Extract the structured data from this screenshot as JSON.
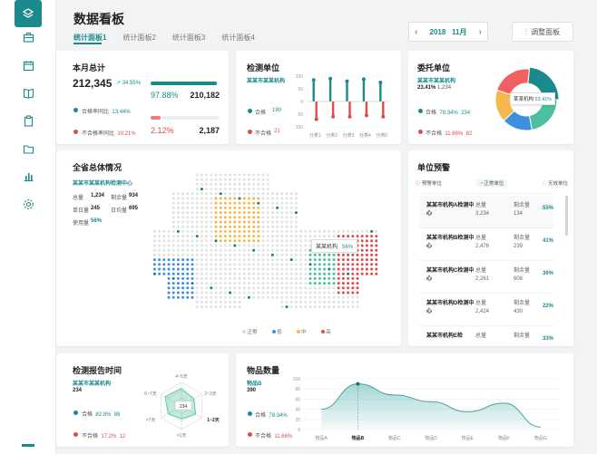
{
  "header": {
    "title": "数据看板",
    "tabs": [
      "统计面板1",
      "统计面板2",
      "统计面板3",
      "统计面板4"
    ],
    "year": "2018",
    "month": "11月",
    "adjust_label": "调整面板"
  },
  "sidebar": {
    "icons": [
      "layers-icon",
      "briefcase-icon",
      "calendar-icon",
      "book-icon",
      "clipboard-icon",
      "folder-icon",
      "bar-chart-icon",
      "settings-icon"
    ]
  },
  "monthly": {
    "title": "本月总计",
    "total": "212,345",
    "trend": "34.55%",
    "pass_label": "合格率同比",
    "pass_rate": "13.44%",
    "fail_label": "不合格率同比",
    "fail_rate": "10.21%",
    "pass_pct": "97.88%",
    "pass_count": "210,182",
    "pass_fill": 0.9788,
    "fail_pct": "2.12%",
    "fail_count": "2,187",
    "fail_fill": 0.15
  },
  "test_units": {
    "title": "检测单位",
    "org": "某某市某某机构",
    "pass_label": "合格",
    "pass_val": "190",
    "fail_label": "不合格",
    "fail_val": "21",
    "y_ticks": [
      "100",
      "50",
      "0",
      "50",
      "100"
    ],
    "categories": [
      "分类1",
      "分类2",
      "分类3",
      "分类4",
      "分类0"
    ]
  },
  "commission": {
    "title": "委托单位",
    "org": "某某市某某机构",
    "rate": "23.41%",
    "rate_suffix": "1,234",
    "pass_label": "合格",
    "pass_pct": "78.34%",
    "pass_val": "234",
    "fail_label": "不合格",
    "fail_pct": "11.66%",
    "fail_val": "82",
    "donut_label": "某某机构",
    "donut_pct": "23.41%"
  },
  "province": {
    "title": "全省总体情况",
    "org": "某某市某某机构检测中心",
    "total_label": "总量",
    "total_val": "1,234",
    "remain_label": "剩余量",
    "remain_val": "934",
    "single_label": "单日量",
    "single_val": "245",
    "daily_label": "日均量",
    "daily_val": "695",
    "usage_label": "使用量",
    "usage_val": "56%",
    "tooltip_name": "某某机构",
    "tooltip_pct": "56%",
    "legend": [
      "正常",
      "低",
      "中",
      "高"
    ]
  },
  "warning": {
    "title": "单位预警",
    "legend": [
      "预警单位",
      "正常单位",
      "无效单位"
    ],
    "rows": [
      {
        "name": "某某市机构A检测中心",
        "total_label": "总量",
        "total": "3,234",
        "remain_label": "剩余量",
        "remain": "134",
        "pct": "55%"
      },
      {
        "name": "某某市机构B检测中心",
        "total_label": "总量",
        "total": "2,476",
        "remain_label": "剩余量",
        "remain": "239",
        "pct": "41%"
      },
      {
        "name": "某某市机构C检测中心",
        "total_label": "总量",
        "total": "2,261",
        "remain_label": "剩余量",
        "remain": "608",
        "pct": "36%"
      },
      {
        "name": "某某市机构D检测中心",
        "total_label": "总量",
        "total": "2,424",
        "remain_label": "剩余量",
        "remain": "430",
        "pct": "22%"
      },
      {
        "name": "某某市机构E检",
        "total_label": "总量",
        "total": "",
        "remain_label": "剩余量",
        "remain": "",
        "pct": "33%"
      }
    ]
  },
  "report_time": {
    "title": "检测报告时间",
    "org": "某某市某某机构",
    "value": "234",
    "pass_label": "合格",
    "pass_pct": "82.8%",
    "pass_val": "88",
    "fail_label": "不合格",
    "fail_pct": "17.2%",
    "fail_val": "12",
    "radar_axes": [
      "4~5天",
      "2~3天",
      "1~2天",
      "<1天",
      ">7天",
      "6~7天"
    ],
    "radar_center": "234"
  },
  "goods": {
    "title": "物品数量",
    "item_label": "物品B",
    "item_val": "390",
    "pass_label": "合格",
    "pass_pct": "78.34%",
    "fail_label": "不合格",
    "fail_pct": "11.66%"
  },
  "chart_data": [
    {
      "type": "bar",
      "title": "检测单位",
      "categories": [
        "分类1",
        "分类2",
        "分类3",
        "分类4",
        "分类0"
      ],
      "ylim": [
        -100,
        100
      ],
      "series": [
        {
          "name": "合格",
          "color": "#1a8a8c",
          "values": [
            [
              70,
              85
            ],
            [
              70,
              90
            ],
            [
              60,
              80
            ],
            [
              70,
              88
            ],
            [
              50,
              75
            ]
          ]
        },
        {
          "name": "不合格",
          "color": "#e04b4b",
          "values": [
            [
              -55,
              -70
            ],
            [
              -30,
              -60
            ],
            [
              -45,
              -60
            ],
            [
              -40,
              -55
            ],
            [
              -55,
              -60
            ]
          ]
        }
      ]
    },
    {
      "type": "pie",
      "title": "委托单位",
      "slices": [
        {
          "label": "某某机构",
          "value": 23.41,
          "color": "#1a8a8c"
        },
        {
          "label": "",
          "value": 22,
          "color": "#4cbfa0"
        },
        {
          "label": "",
          "value": 16,
          "color": "#3e8fe0"
        },
        {
          "label": "",
          "value": 17,
          "color": "#f5b84c"
        },
        {
          "label": "",
          "value": 21.59,
          "color": "#f06060"
        }
      ]
    },
    {
      "type": "area",
      "title": "物品数量",
      "categories": [
        "物品A",
        "物品B",
        "物品C",
        "物品D",
        "物品E",
        "物品F",
        "物品G"
      ],
      "values": [
        40,
        90,
        68,
        55,
        35,
        52,
        5
      ],
      "ylim": [
        0,
        100
      ],
      "y_ticks": [
        "0",
        "20",
        "40",
        "60",
        "80",
        "100"
      ],
      "highlight": "物品B"
    }
  ]
}
